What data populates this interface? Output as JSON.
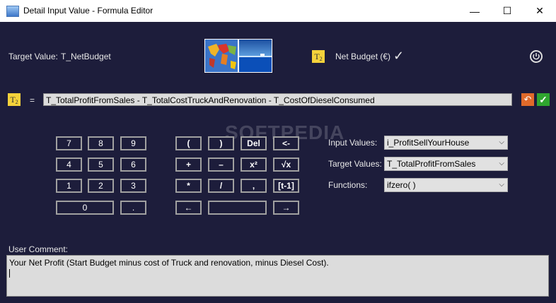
{
  "window": {
    "title": "Detail Input Value - Formula Editor",
    "controls": {
      "minimize": "—",
      "maximize": "☐",
      "close": "✕"
    }
  },
  "header": {
    "target_value_label": "Target Value:",
    "target_value": "T_NetBudget",
    "badge_text": "T",
    "badge_sub": "2",
    "budget_label": "Net Budget (€)",
    "check": "✓",
    "help_icon": "⏻"
  },
  "formula": {
    "badge_text": "T",
    "badge_sub": "2",
    "equals": "=",
    "expression": "T_TotalProfitFromSales - T_TotalCostTruckAndRenovation - T_CostOfDieselConsumed",
    "undo_icon": "↶",
    "ok_icon": "✓"
  },
  "keypad": {
    "digits": [
      "7",
      "8",
      "9",
      "4",
      "5",
      "6",
      "1",
      "2",
      "3",
      "0",
      "."
    ],
    "operators": [
      "(",
      ")",
      "Del",
      "<-",
      "+",
      "–",
      "x²",
      "√x",
      "*",
      "/",
      ",",
      "[t-1]",
      "←",
      "",
      "→"
    ]
  },
  "inputs": {
    "input_values_label": "Input Values:",
    "input_values_selected": "i_ProfitSellYourHouse",
    "target_values_label": "Target Values:",
    "target_values_selected": "T_TotalProfitFromSales",
    "functions_label": "Functions:",
    "functions_selected": "ifzero( )"
  },
  "comment": {
    "label": "User Comment:",
    "text": "Your Net Profit (Start Budget minus cost of Truck and renovation, minus Diesel Cost)."
  },
  "watermark": "SOFTPEDIA",
  "colors": {
    "background": "#1d1d3b",
    "badge": "#f4d23b",
    "undo": "#e06a2a",
    "ok": "#2fa52f"
  }
}
